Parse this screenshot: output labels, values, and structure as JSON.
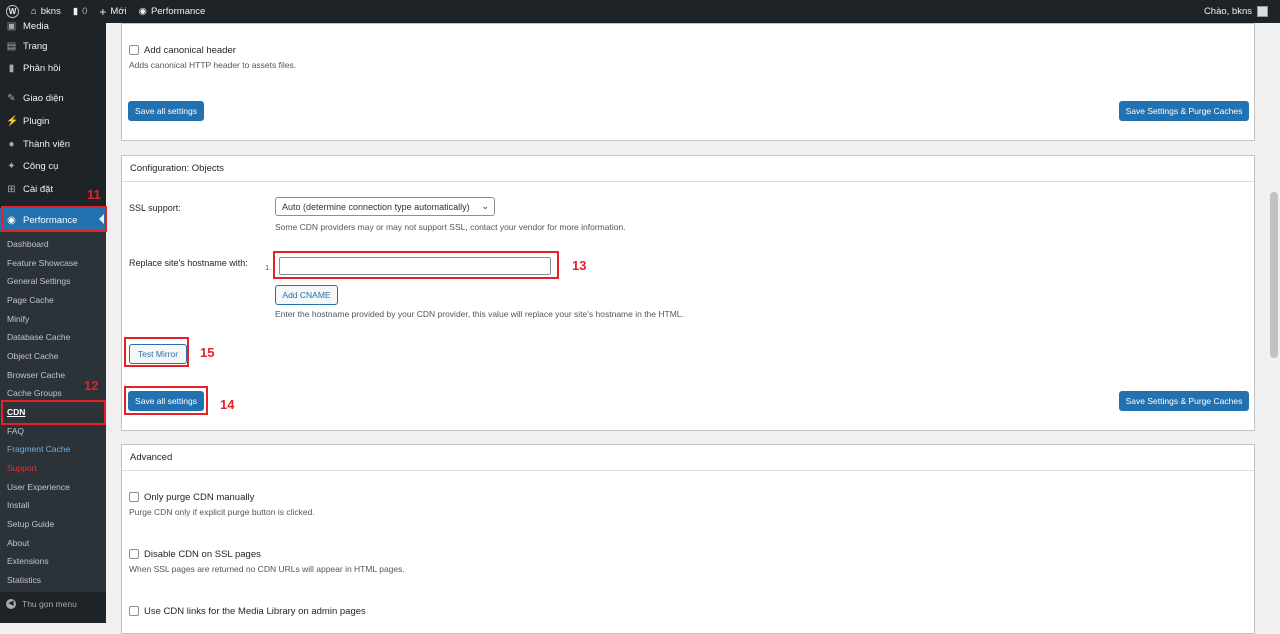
{
  "adminbar": {
    "site_name": "bkns",
    "comments_count": "0",
    "new_label": "Mới",
    "performance_label": "Performance",
    "greeting": "Chào, bkns"
  },
  "sidebar": {
    "menu": [
      {
        "label": "Media",
        "icon": "media-icon"
      },
      {
        "label": "Trang",
        "icon": "page-icon"
      },
      {
        "label": "Phản hồi",
        "icon": "comment-icon"
      },
      {
        "label": "Giao diện",
        "icon": "brush-icon"
      },
      {
        "label": "Plugin",
        "icon": "plugin-icon"
      },
      {
        "label": "Thành viên",
        "icon": "user-icon"
      },
      {
        "label": "Công cụ",
        "icon": "wrench-icon"
      },
      {
        "label": "Cài đặt",
        "icon": "settings-icon"
      },
      {
        "label": "Performance",
        "icon": "performance-icon"
      }
    ],
    "submenu": [
      "Dashboard",
      "Feature Showcase",
      "General Settings",
      "Page Cache",
      "Minify",
      "Database Cache",
      "Object Cache",
      "Browser Cache",
      "Cache Groups",
      "CDN",
      "FAQ",
      "Fragment Cache",
      "Support",
      "User Experience",
      "Install",
      "Setup Guide",
      "About",
      "Extensions",
      "Statistics"
    ],
    "collapse_label": "Thu gọn menu"
  },
  "annotations": [
    "11",
    "12",
    "13",
    "14",
    "15"
  ],
  "panel_top": {
    "canonical_label": "Add canonical header",
    "canonical_desc": "Adds canonical HTTP header to assets files.",
    "save_all": "Save all settings",
    "save_purge": "Save Settings & Purge Caches"
  },
  "panel_config": {
    "title": "Configuration: Objects",
    "ssl_label": "SSL support:",
    "ssl_value": "Auto (determine connection type automatically)",
    "ssl_desc": "Some CDN providers may or may not support SSL, contact your vendor for more information.",
    "hostname_label": "Replace site's hostname with:",
    "hostname_index": "1.",
    "hostname_value": "",
    "add_cname": "Add CNAME",
    "hostname_desc": "Enter the hostname provided by your CDN provider, this value will replace your site's hostname in the HTML.",
    "test_mirror": "Test Mirror",
    "save_all": "Save all settings",
    "save_purge": "Save Settings & Purge Caches"
  },
  "panel_advanced": {
    "title": "Advanced",
    "opt1_label": "Only purge CDN manually",
    "opt1_desc": "Purge CDN only if explicit purge button is clicked.",
    "opt2_label": "Disable CDN on SSL pages",
    "opt2_desc": "When SSL pages are returned no CDN URLs will appear in HTML pages.",
    "opt3_label": "Use CDN links for the Media Library on admin pages"
  }
}
